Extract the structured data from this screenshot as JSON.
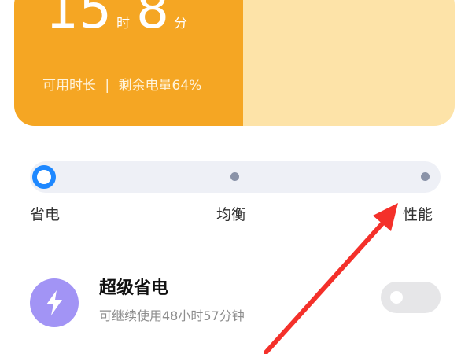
{
  "battery": {
    "hours": "15",
    "hours_unit": "时",
    "minutes": "8",
    "minutes_unit": "分",
    "available_label": "可用时长",
    "separator": "|",
    "remaining_label": "剩余电量64%",
    "level_percent": 52,
    "fill_color": "#f5a623",
    "empty_color": "#fde3a8"
  },
  "power_modes": {
    "selected": "省电",
    "options": [
      {
        "label": "省电"
      },
      {
        "label": "均衡"
      },
      {
        "label": "性能"
      }
    ],
    "accent_color": "#1e88ff"
  },
  "super_saver": {
    "icon": "lightning-bolt-icon",
    "title": "超级省电",
    "subtitle": "可继续使用48小时57分钟",
    "enabled": false,
    "icon_bg_color": "#a294f5"
  },
  "annotation": {
    "arrow_color": "#f4302a"
  }
}
